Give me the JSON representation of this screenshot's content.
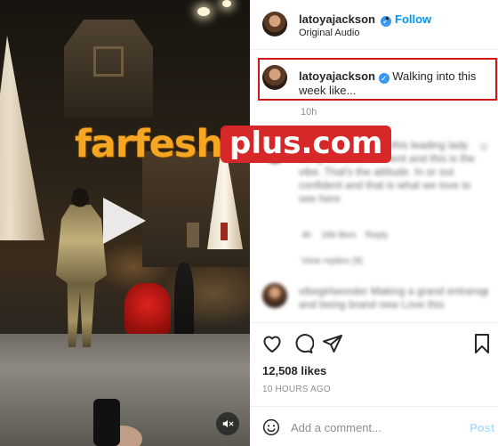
{
  "post": {
    "username": "latoyajackson",
    "verified_symbol": "✓",
    "dot": "•",
    "follow_label": "Follow",
    "audio": "Original Audio"
  },
  "caption": {
    "username": "latoyajackson",
    "text": "Walking into this week like...",
    "time": "10h"
  },
  "comments": [
    {
      "lines": [
        "farfesh plus Loving this leading lady",
        "living her best moment and this is the",
        "vibe. That's the attitude. In or out",
        "confident and that is what we love to",
        "see here"
      ],
      "meta": [
        "4h",
        "186 likes",
        "Reply"
      ],
      "replies": "View replies (9)"
    },
    {
      "lines": [
        "vibegirlwonder Making a grand entrance",
        "and being brand new Love this"
      ]
    }
  ],
  "stats": {
    "likes": "12,508 likes",
    "ago": "10 HOURS AGO"
  },
  "add_comment": {
    "placeholder": "Add a comment...",
    "post_label": "Post"
  },
  "watermark": {
    "part1": "farfesh",
    "part2": "plus.com"
  },
  "icons": {
    "play": "play-icon",
    "mute": "muted-speaker-icon",
    "like": "heart-icon",
    "comment": "comment-icon",
    "share": "paper-plane-icon",
    "save": "bookmark-icon",
    "emoji": "smiley-icon"
  },
  "colors": {
    "link_blue": "#0095f6",
    "verified_blue": "#3897f0",
    "highlight_red": "#d01616",
    "watermark_orange": "#f5a623",
    "watermark_red": "#d62828"
  }
}
